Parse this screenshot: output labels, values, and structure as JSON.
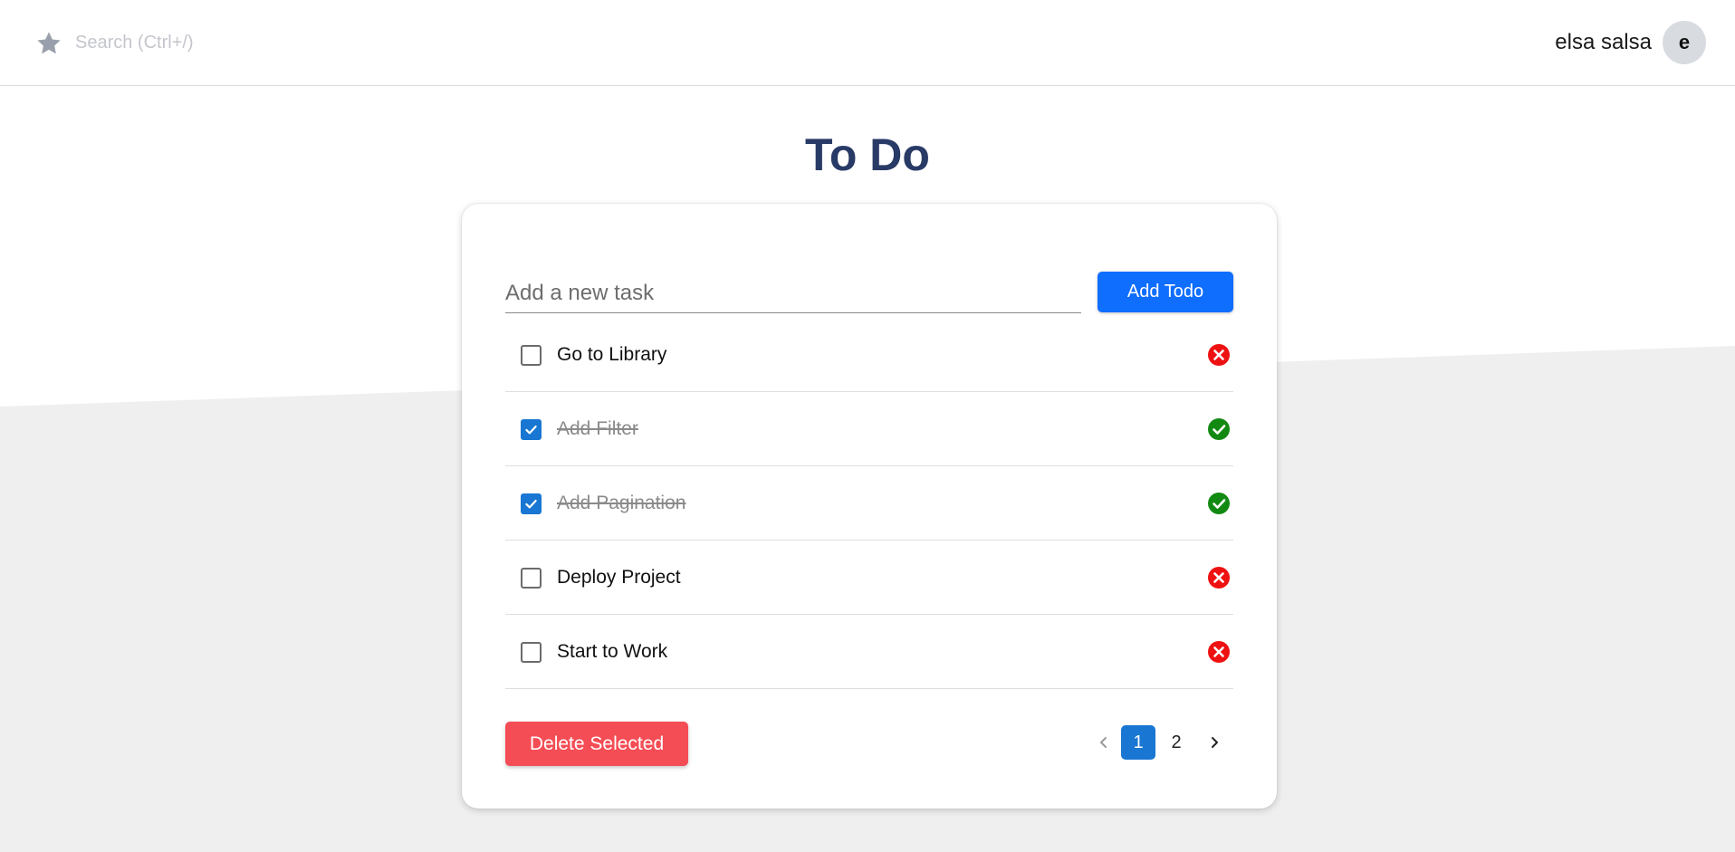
{
  "header": {
    "search_placeholder": "Search (Ctrl+/)",
    "username": "elsa salsa",
    "avatar_initial": "e"
  },
  "page": {
    "title": "To Do"
  },
  "form": {
    "input_placeholder": "Add a new task",
    "input_value": "",
    "add_label": "Add Todo"
  },
  "todos": [
    {
      "text": "Go to Library",
      "done": false
    },
    {
      "text": "Add Filter",
      "done": true
    },
    {
      "text": "Add Pagination",
      "done": true
    },
    {
      "text": "Deploy Project",
      "done": false
    },
    {
      "text": "Start to Work",
      "done": false
    }
  ],
  "footer": {
    "delete_label": "Delete Selected",
    "pages": [
      "1",
      "2"
    ],
    "current_page": "1"
  },
  "colors": {
    "accent": "#0f6efd",
    "checkbox": "#1976d2",
    "danger": "#f44d55",
    "status_done": "#128a12",
    "status_pending": "#ee1111",
    "title": "#283a66",
    "lower_background": "#efefef"
  },
  "icons": {
    "logo": "star-icon",
    "done": "check-circle-icon",
    "pending": "x-circle-icon",
    "prev": "chevron-left-icon",
    "next": "chevron-right-icon"
  }
}
